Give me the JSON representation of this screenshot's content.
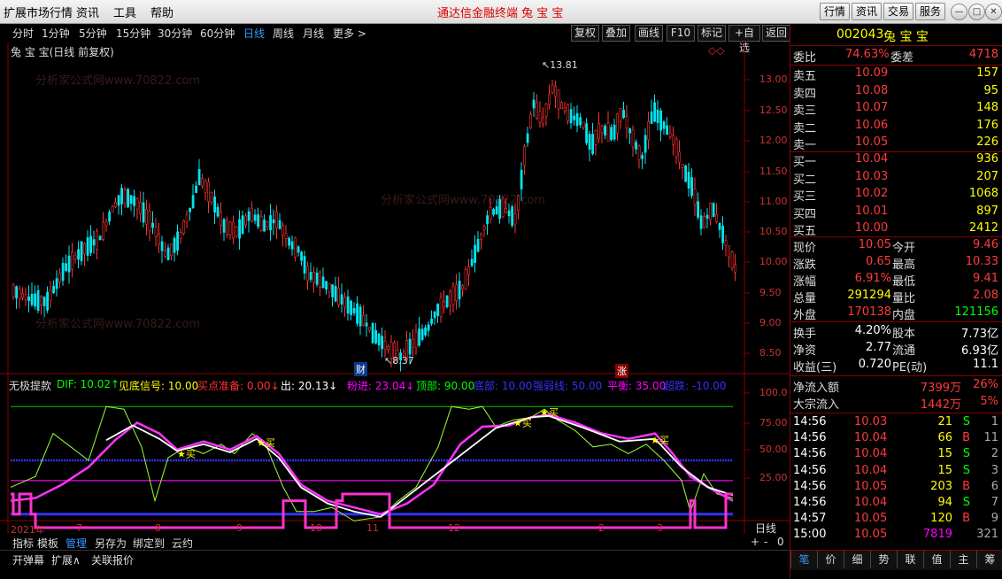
{
  "titlebar": {
    "menu": [
      "扩展市场行情",
      "资讯",
      "工具",
      "帮助"
    ],
    "app_title": "通达信金融终端   兔 宝 宝",
    "right_buttons": [
      "行情",
      "资讯",
      "交易",
      "服务"
    ]
  },
  "periods": [
    "分时",
    "1分钟",
    "5分钟",
    "15分钟",
    "30分钟",
    "60分钟",
    "日线",
    "周线",
    "月线",
    "更多 >"
  ],
  "active_period": "日线",
  "toolbar": [
    "复权",
    "叠加",
    "画线",
    "F10",
    "标记",
    "+自选",
    "返回"
  ],
  "chart_title": "兔 宝 宝(日线 前复权)",
  "watermark": "分析家公式网www.70822.com",
  "stock": {
    "code": "002043",
    "name": "兔 宝 宝"
  },
  "orderbook": {
    "weibi_label": "委比",
    "weibi": "74.63%",
    "weicha_label": "委差",
    "weicha": "4718",
    "sell": [
      {
        "label": "卖五",
        "price": "10.09",
        "vol": "157"
      },
      {
        "label": "卖四",
        "price": "10.08",
        "vol": "95"
      },
      {
        "label": "卖三",
        "price": "10.07",
        "vol": "148"
      },
      {
        "label": "卖二",
        "price": "10.06",
        "vol": "176"
      },
      {
        "label": "卖一",
        "price": "10.05",
        "vol": "226"
      }
    ],
    "buy": [
      {
        "label": "买一",
        "price": "10.04",
        "vol": "936"
      },
      {
        "label": "买二",
        "price": "10.03",
        "vol": "207"
      },
      {
        "label": "买三",
        "price": "10.02",
        "vol": "1068"
      },
      {
        "label": "买四",
        "price": "10.01",
        "vol": "897"
      },
      {
        "label": "买五",
        "price": "10.00",
        "vol": "2412"
      }
    ]
  },
  "quote": [
    {
      "l1": "现价",
      "v1": "10.05",
      "c1": "red",
      "l2": "今开",
      "v2": "9.46",
      "c2": "red"
    },
    {
      "l1": "涨跌",
      "v1": "0.65",
      "c1": "red",
      "l2": "最高",
      "v2": "10.33",
      "c2": "red"
    },
    {
      "l1": "涨幅",
      "v1": "6.91%",
      "c1": "red",
      "l2": "最低",
      "v2": "9.41",
      "c2": "red"
    },
    {
      "l1": "总量",
      "v1": "291294",
      "c1": "yellow",
      "l2": "量比",
      "v2": "2.08",
      "c2": "red"
    },
    {
      "l1": "外盘",
      "v1": "170138",
      "c1": "red",
      "l2": "内盘",
      "v2": "121156",
      "c2": "green"
    },
    {
      "l1": "换手",
      "v1": "4.20%",
      "c1": "white",
      "l2": "股本",
      "v2": "7.73亿",
      "c2": "white"
    },
    {
      "l1": "净资",
      "v1": "2.77",
      "c1": "white",
      "l2": "流通",
      "v2": "6.93亿",
      "c2": "white"
    },
    {
      "l1": "收益(三)",
      "v1": "0.720",
      "c1": "white",
      "l2": "PE(动)",
      "v2": "11.1",
      "c2": "white"
    }
  ],
  "flows": [
    {
      "label": "净流入额",
      "value": "7399万",
      "pct": "26%"
    },
    {
      "label": "大宗流入",
      "value": "1442万",
      "pct": "5%"
    }
  ],
  "ticks": [
    {
      "time": "14:56",
      "price": "10.03",
      "vol": "21",
      "side": "S",
      "n": "1"
    },
    {
      "time": "14:56",
      "price": "10.04",
      "vol": "66",
      "side": "B",
      "n": "11"
    },
    {
      "time": "14:56",
      "price": "10.04",
      "vol": "15",
      "side": "S",
      "n": "2"
    },
    {
      "time": "14:56",
      "price": "10.04",
      "vol": "15",
      "side": "S",
      "n": "3"
    },
    {
      "time": "14:56",
      "price": "10.05",
      "vol": "203",
      "side": "B",
      "n": "6"
    },
    {
      "time": "14:56",
      "price": "10.04",
      "vol": "94",
      "side": "S",
      "n": "7"
    },
    {
      "time": "14:57",
      "price": "10.05",
      "vol": "120",
      "side": "B",
      "n": "9"
    },
    {
      "time": "15:00",
      "price": "10.05",
      "vol": "7819",
      "side": "",
      "n": "321"
    }
  ],
  "indicator": {
    "name": "无极提款",
    "items": [
      {
        "text": "DIF: 10.02↑",
        "color": "#0f0"
      },
      {
        "text": "见底信号: 10.00",
        "color": "#ff0"
      },
      {
        "text": "买点准备: 0.00↓",
        "color": "#f33"
      },
      {
        "text": "出: 20.13↓",
        "color": "#fff"
      },
      {
        "text": "粉进: 23.04↓",
        "color": "#f0f"
      },
      {
        "text": "顶部: 90.00",
        "color": "#0f0"
      },
      {
        "text": "底部: 10.00",
        "color": "#33f"
      },
      {
        "text": "强弱线: 50.00",
        "color": "#33f"
      },
      {
        "text": "平衡: 35.00",
        "color": "#f0f"
      },
      {
        "text": "超跌: -10.00",
        "color": "#33f"
      }
    ],
    "axis": [
      "100.0",
      "75.00",
      "50.00",
      "25.00"
    ]
  },
  "price_axis": [
    "13.00",
    "12.50",
    "12.00",
    "11.50",
    "11.00",
    "10.50",
    "10.00",
    "9.50",
    "9.00",
    "8.50"
  ],
  "annotations": {
    "high": "13.81",
    "low": "8.37",
    "cai": "财",
    "zhang": "涨",
    "buy_label": "买"
  },
  "x_labels": [
    "2021年",
    "7",
    "8",
    "9",
    "10",
    "11",
    "12",
    "2",
    "3"
  ],
  "period_label": "日线",
  "bottom_tabs": [
    "指标",
    "模板",
    "管理",
    "另存为",
    "绑定到",
    "云约"
  ],
  "bottom_tabs2": [
    "开弹幕",
    "扩展∧",
    "关联报价"
  ],
  "footer_tabs": [
    "笔",
    "价",
    "细",
    "势",
    "联",
    "值",
    "主",
    "筹"
  ],
  "zoom": [
    "+",
    "-",
    "0"
  ]
}
